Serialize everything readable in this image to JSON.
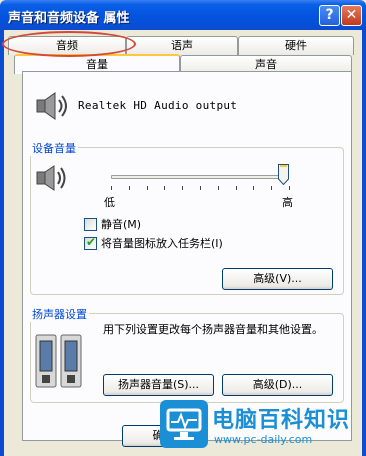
{
  "window": {
    "title": "声音和音频设备 属性",
    "help_glyph": "?",
    "close_glyph": "✕"
  },
  "tabs": {
    "row1": [
      "音频",
      "语声",
      "硬件"
    ],
    "row2": [
      "音量",
      "声音"
    ],
    "selected": "音量"
  },
  "device": {
    "name": "Realtek HD Audio output"
  },
  "device_volume": {
    "label": "设备音量",
    "low_label": "低",
    "high_label": "高",
    "level": 1.0,
    "mute_label": "静音(M)",
    "mute_checked": false,
    "tray_label": "将音量图标放入任务栏(I)",
    "tray_checked": true,
    "advanced_button": "高级(V)..."
  },
  "speaker_settings": {
    "label": "扬声器设置",
    "description": "用下列设置更改每个扬声器音量和其他设置。",
    "volume_button": "扬声器音量(S)...",
    "advanced_button": "高级(D)..."
  },
  "footer": {
    "ok_button_partial": "确"
  },
  "watermark": {
    "title": "电脑百科知识",
    "url": "www.pc-daily.com"
  }
}
